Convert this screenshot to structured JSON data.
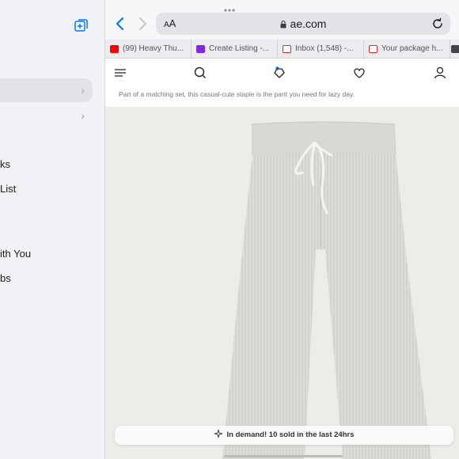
{
  "sidebar": {
    "items": [
      {
        "label": "",
        "chevron": true
      },
      {
        "label": "",
        "chevron": true
      },
      {
        "label": "ks"
      },
      {
        "label": "List"
      },
      {
        "label": "ith You"
      },
      {
        "label": "bs"
      }
    ],
    "icons": {
      "new_tab_group": "new-tab-group-icon"
    }
  },
  "toolbar": {
    "text_size_label_small": "A",
    "text_size_label_large": "A",
    "url": "ae.com",
    "colors": {
      "accent": "#007aff"
    }
  },
  "tabs": [
    {
      "label": "(99) Heavy Thu...",
      "favicon_color": "#ff0000"
    },
    {
      "label": "Create Listing -...",
      "favicon_color": "#7d2ae8"
    },
    {
      "label": "Inbox (1,548) -...",
      "favicon_color": "#d93025"
    },
    {
      "label": "Your package h...",
      "favicon_color": "#d93025"
    }
  ],
  "page": {
    "description": "Part of a matching set, this casual-cute staple is the pant you need for lazy day.",
    "banner": "In demand! 10 sold in the last 24hrs",
    "product_image": "gray ribbed knit pants with drawstring"
  }
}
